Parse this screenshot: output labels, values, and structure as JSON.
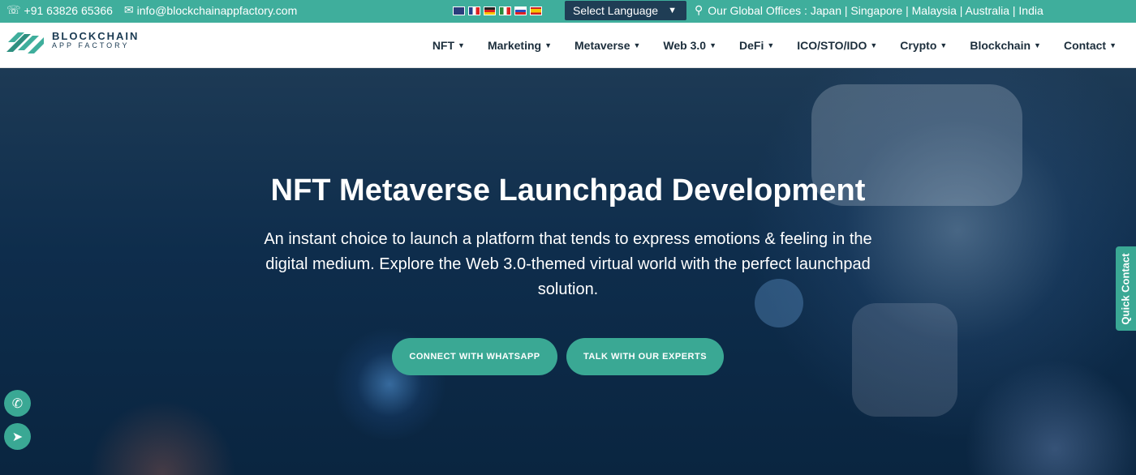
{
  "topbar": {
    "phone": "+91 63826 65366",
    "email": "info@blockchainappfactory.com",
    "language_label": "Select Language",
    "offices": "Our Global Offices : Japan | Singapore | Malaysia | Australia | India"
  },
  "logo": {
    "line1": "BLOCKCHAIN",
    "line2": "APP FACTORY"
  },
  "menu": [
    "NFT",
    "Marketing",
    "Metaverse",
    "Web 3.0",
    "DeFi",
    "ICO/STO/IDO",
    "Crypto",
    "Blockchain",
    "Contact"
  ],
  "hero": {
    "title": "NFT Metaverse Launchpad Development",
    "subtitle": "An instant choice to launch a platform that tends to express emotions & feeling in the digital medium. Explore the Web 3.0-themed virtual world with the perfect launchpad solution.",
    "btn_whatsapp": "CONNECT WITH WHATSAPP",
    "btn_experts": "TALK WITH OUR EXPERTS"
  },
  "quick_contact": "Quick Contact",
  "icons": [
    "phone-icon",
    "mail-icon",
    "map-marker-icon",
    "whatsapp-icon",
    "telegram-icon"
  ],
  "colors": {
    "accent": "#3fae9c",
    "nav_text": "#1c2e3c",
    "lang_bg": "#1f3d55"
  }
}
